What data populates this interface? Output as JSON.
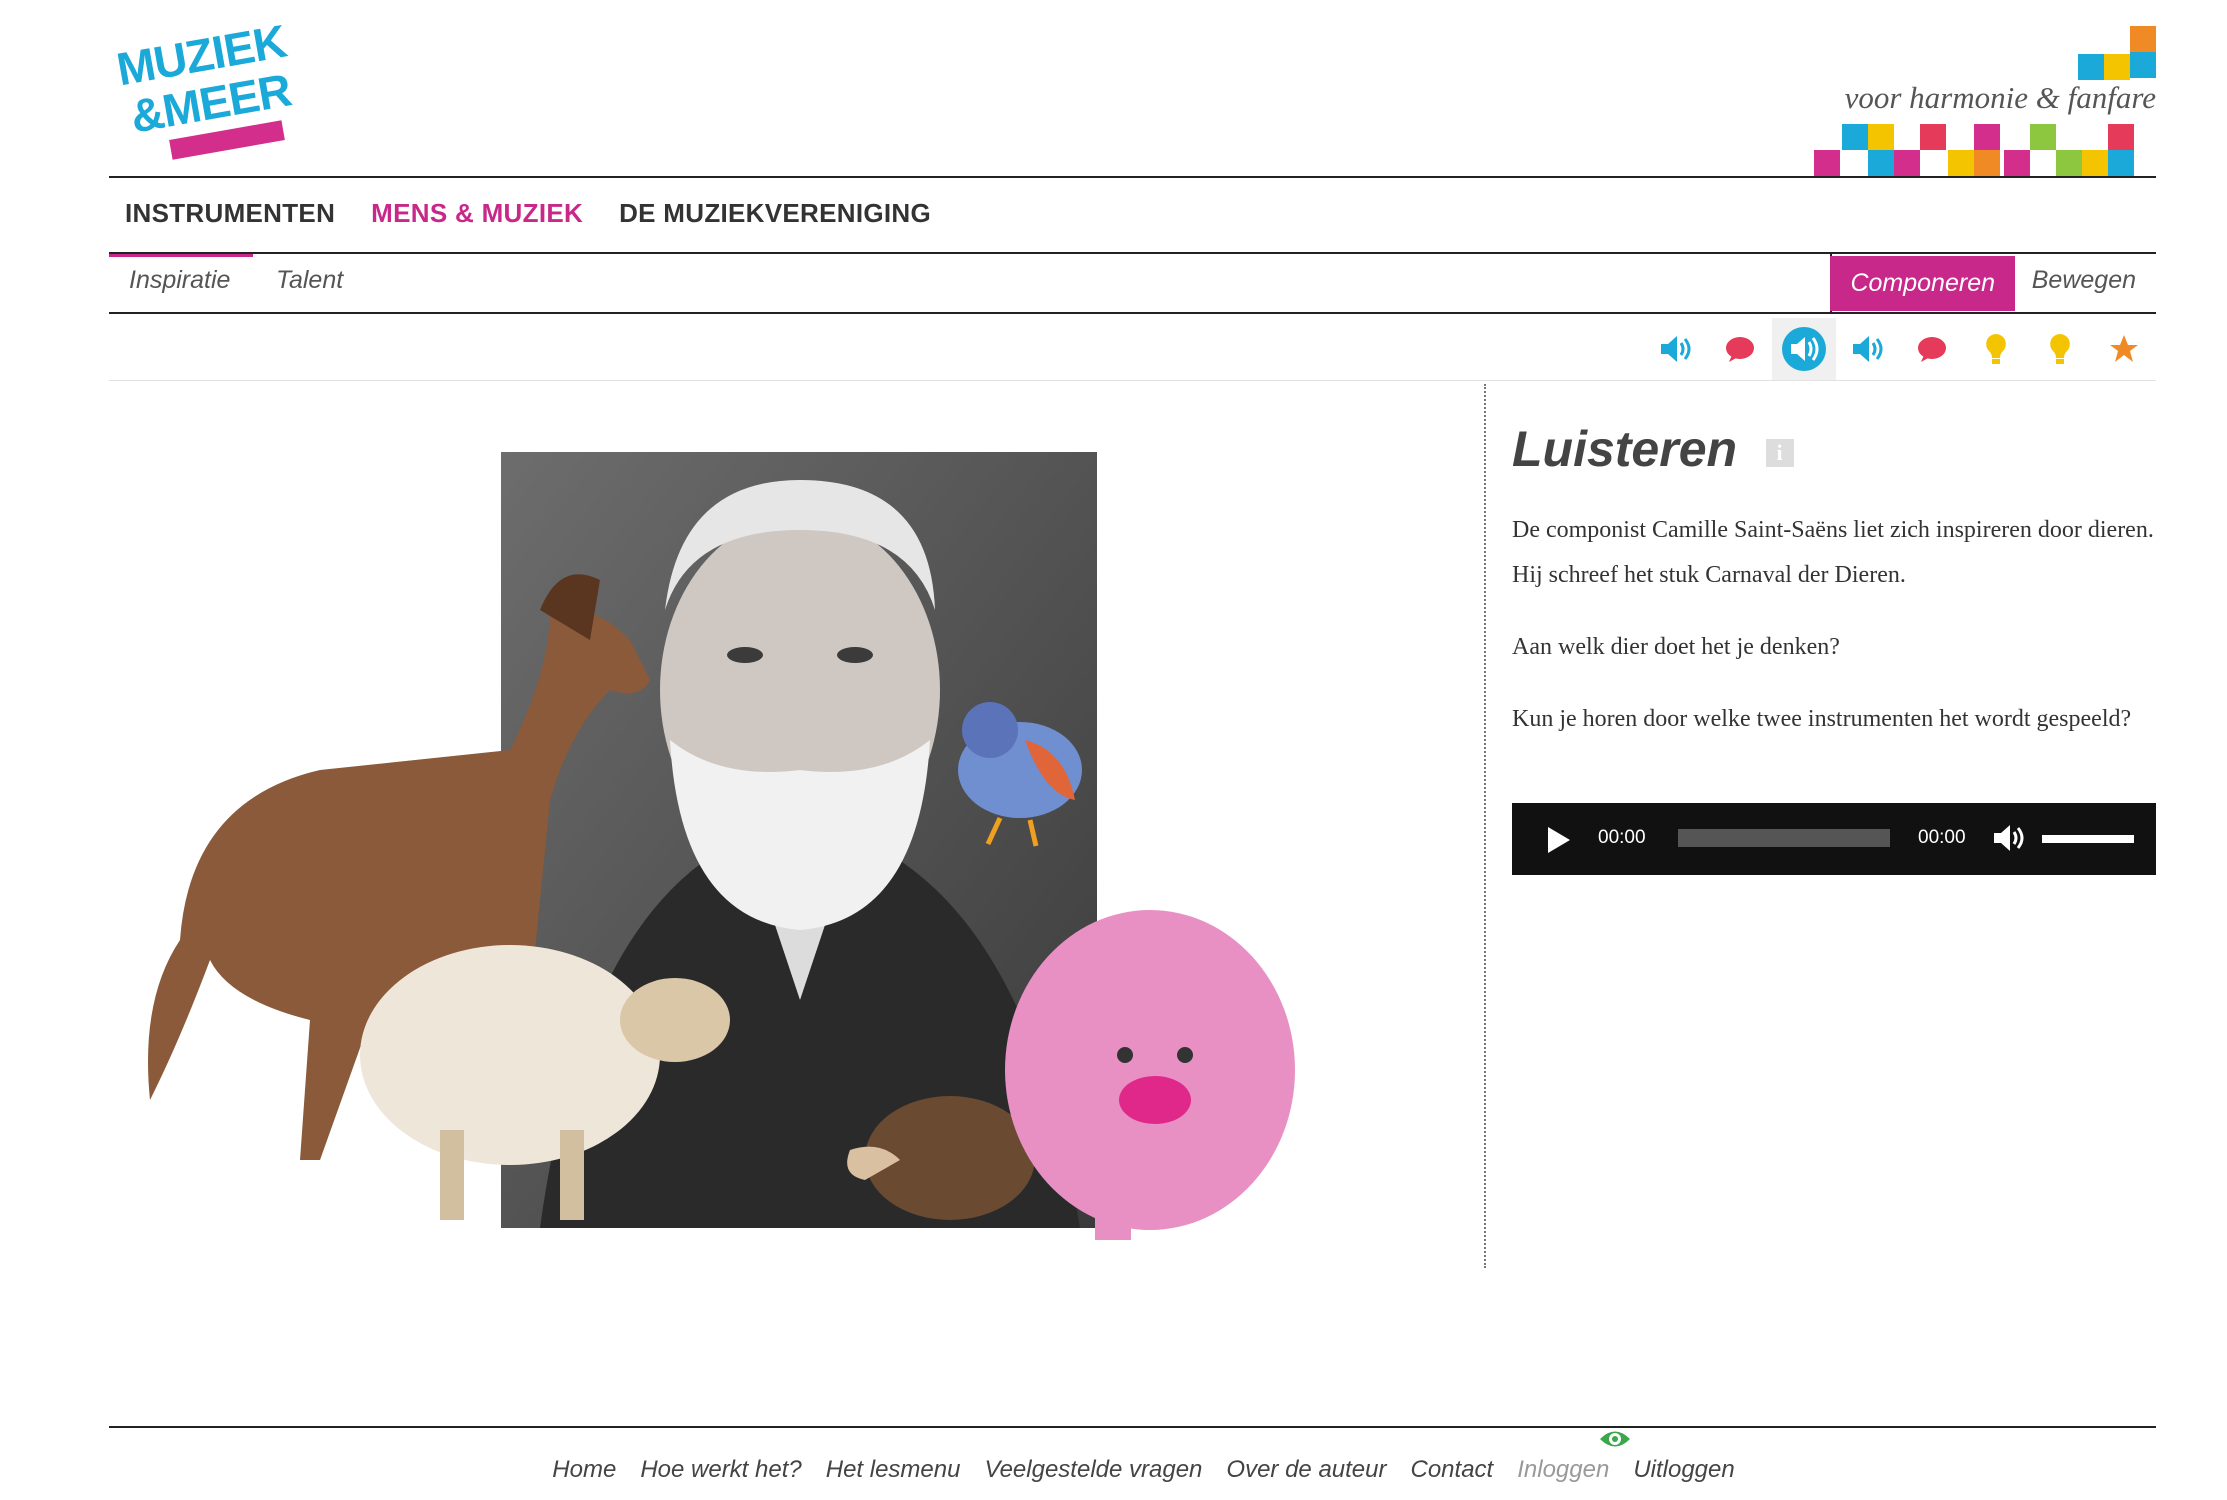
{
  "brand": {
    "logo_line1": "MUZIEK",
    "logo_line2": "&MEER",
    "tagline": "voor harmonie & fanfare",
    "accent_pink": "#c8288a",
    "accent_blue": "#1aa9d8"
  },
  "main_nav": [
    {
      "label": "INSTRUMENTEN",
      "active": false
    },
    {
      "label": "MENS & MUZIEK",
      "active": true
    },
    {
      "label": "DE MUZIEKVERENIGING",
      "active": false
    }
  ],
  "sub_nav": {
    "left": [
      "Inspiratie",
      "Talent"
    ],
    "active_left": "Inspiratie",
    "right": [
      "Componeren",
      "Bewegen"
    ],
    "active_right": "Componeren"
  },
  "activity_icons": [
    {
      "icon": "speaker-icon",
      "color": "#1aa9d8"
    },
    {
      "icon": "speech-bubble-icon",
      "color": "#e63a5a"
    },
    {
      "icon": "speaker-active-icon",
      "color": "#1aa9d8",
      "selected": true
    },
    {
      "icon": "speaker-icon",
      "color": "#1aa9d8"
    },
    {
      "icon": "speech-bubble-icon",
      "color": "#e63a5a"
    },
    {
      "icon": "lightbulb-icon",
      "color": "#f5c400"
    },
    {
      "icon": "lightbulb-icon",
      "color": "#f5c400"
    },
    {
      "icon": "star-icon",
      "color": "#f08a24"
    }
  ],
  "panel": {
    "title": "Luisteren",
    "info_label": "i",
    "paragraphs": [
      "De componist Camille Saint-Saëns liet zich inspireren door dieren. Hij schreef het stuk Carnaval der Dieren.",
      "Aan welk dier doet het je denken?",
      "Kun je horen door welke twee instrumenten het wordt gespeeld?"
    ]
  },
  "player": {
    "current_time": "00:00",
    "duration": "00:00",
    "progress": 0,
    "volume": 1
  },
  "footer": {
    "links": [
      "Home",
      "Hoe werkt het?",
      "Het lesmenu",
      "Veelgestelde vragen",
      "Over de auteur",
      "Contact",
      "Inloggen",
      "Uitloggen"
    ],
    "dimmed": "Inloggen"
  }
}
